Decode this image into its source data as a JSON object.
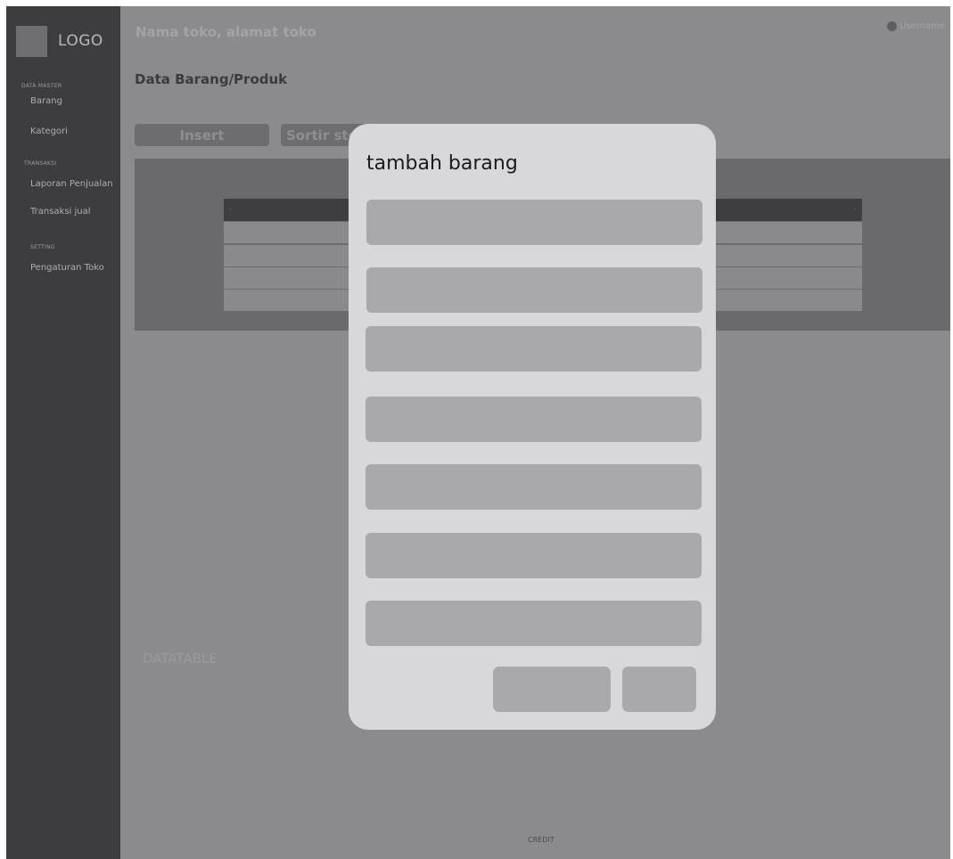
{
  "header": {
    "store": "Nama toko, alamat toko",
    "user": "Username"
  },
  "sidebar": {
    "logo": "LOGO",
    "sections": [
      {
        "title": "DATA MASTER",
        "items": [
          "Barang",
          "Kategori"
        ]
      },
      {
        "title": "TRANSAKSI",
        "items": [
          "Laporan Penjualan",
          "Transaksi jual"
        ]
      },
      {
        "title": "SETTING",
        "items": [
          "Pengaturan Toko"
        ]
      }
    ]
  },
  "page": {
    "title": "Data Barang/Produk",
    "insert_label": "Insert",
    "sort_label": "Sortir stok",
    "datatable_label": "DATATABLE",
    "credit": "CREDIT"
  },
  "table": {
    "rows": [
      {
        "left": "-",
        "right": "-"
      },
      {
        "left": "-",
        "right": "-"
      },
      {
        "left": "-",
        "right": "-"
      },
      {
        "left": "-",
        "right": "-"
      },
      {
        "left": "-",
        "right": "-"
      }
    ]
  },
  "modal": {
    "title": "tambah barang"
  },
  "colors": {
    "sidebar": "#3d3d3f",
    "overlay": "#8b8a8c",
    "modal": "#d8d7d9",
    "field": "#a9a8aa"
  },
  "icons": {
    "avatar": "user-avatar-icon"
  }
}
